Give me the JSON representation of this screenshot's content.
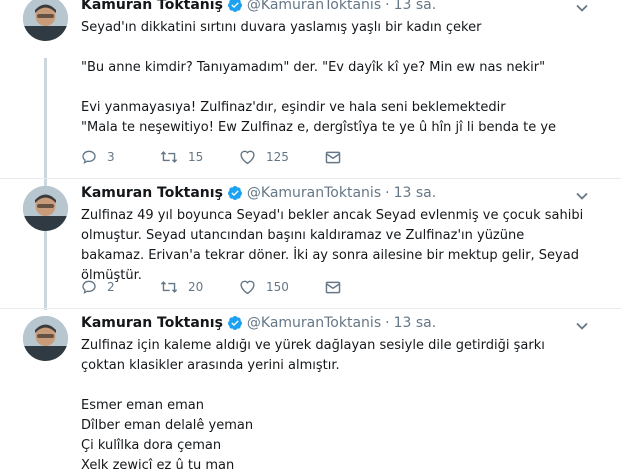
{
  "tweets": [
    {
      "name": "Kamuran Toktanış",
      "handle": "@KamuranToktanis",
      "separator": "·",
      "time": "13 sa.",
      "text": "Seyad'ın dikkatini sırtını duvara yaslamış yaşlı bir kadın çeker\n\n\"Bu anne kimdir? Tanıyamadım\" der. \"Ev dayîk kî ye? Min ew nas nekir\"\n\nEvi yanmayasıya! Zulfinaz'dır, eşindir ve hala seni beklemektedir\n\"Mala te neşewitiyo! Ew Zulfinaz e, dergîstîya te ye û hîn jî li benda te ye",
      "replies": "3",
      "retweets": "15",
      "likes": "125"
    },
    {
      "name": "Kamuran Toktanış",
      "handle": "@KamuranToktanis",
      "separator": "·",
      "time": "13 sa.",
      "text": "Zulfinaz 49 yıl boyunca Seyad'ı bekler ancak Seyad evlenmiş ve çocuk sahibi olmuştur. Seyad utancından başını kaldıramaz ve Zulfinaz'ın yüzüne bakamaz. Erivan'a tekrar döner. İki ay sonra ailesine bir mektup gelir, Seyad ölmüştür.",
      "replies": "2",
      "retweets": "20",
      "likes": "150"
    },
    {
      "name": "Kamuran Toktanış",
      "handle": "@KamuranToktanis",
      "separator": "·",
      "time": "13 sa.",
      "text": "Zulfinaz için kaleme aldığı ve yürek dağlayan sesiyle dile getirdiği şarkı çoktan klasikler arasında yerini almıştır.\n\nEsmer eman eman\nDîlber eman delalê yeman\nÇi kulîlka dora çeman\nXelk zewicî ez û tu man"
    }
  ],
  "colors": {
    "verified": "#1da1f2",
    "muted": "#657786",
    "text": "#14171a",
    "divider": "#e6ecf0",
    "thread_line": "#ccd6dd"
  },
  "icons": {
    "reply": "reply-icon",
    "retweet": "retweet-icon",
    "like": "heart-icon",
    "dm": "envelope-icon",
    "menu": "chevron-down-icon",
    "verified": "verified-badge-icon"
  }
}
